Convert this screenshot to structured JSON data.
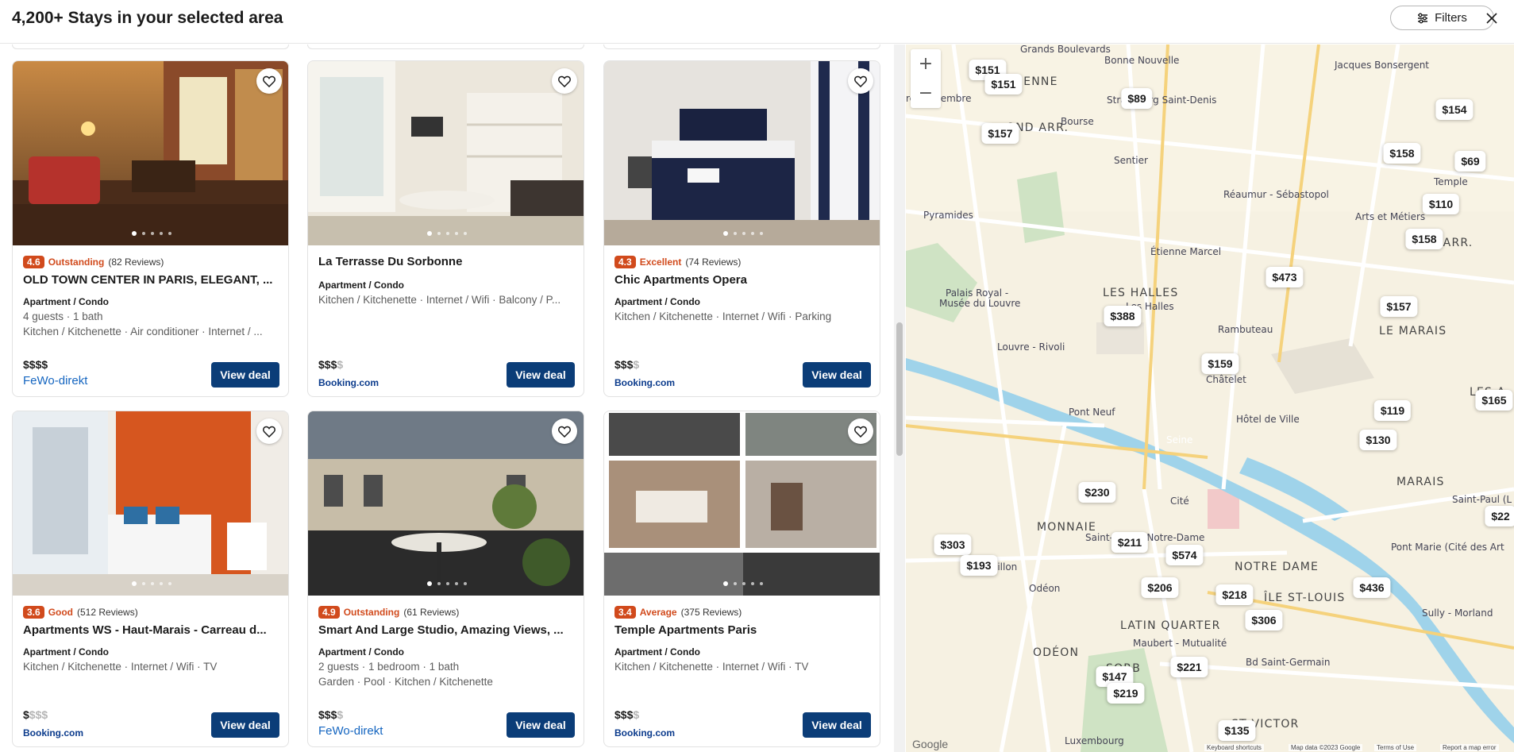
{
  "header": {
    "title": "4,200+ Stays in your selected area",
    "filters_label": "Filters"
  },
  "listings": [
    {
      "score": "4.6",
      "rating_label": "Outstanding",
      "reviews": "(82 Reviews)",
      "name": "OLD TOWN CENTER IN PARIS, ELEGANT, ...",
      "type": "Apartment / Condo",
      "details": [
        "4 guests · 1 bath",
        "Kitchen / Kitchenette · Air conditioner · Internet / ..."
      ],
      "price_active": "$$$$",
      "price_dim": "",
      "provider": "FeWo-direkt",
      "cta": "View deal"
    },
    {
      "score": "",
      "rating_label": "",
      "reviews": "",
      "name": "La Terrasse Du Sorbonne",
      "type": "Apartment / Condo",
      "details": [
        "Kitchen / Kitchenette · Internet / Wifi · Balcony / P..."
      ],
      "price_active": "$$$",
      "price_dim": "$",
      "provider": "Booking.com",
      "cta": "View deal"
    },
    {
      "score": "4.3",
      "rating_label": "Excellent",
      "reviews": "(74 Reviews)",
      "name": "Chic Apartments Opera",
      "type": "Apartment / Condo",
      "details": [
        "Kitchen / Kitchenette · Internet / Wifi · Parking"
      ],
      "price_active": "$$$",
      "price_dim": "$",
      "provider": "Booking.com",
      "cta": "View deal"
    },
    {
      "score": "3.6",
      "rating_label": "Good",
      "reviews": "(512 Reviews)",
      "name": "Apartments WS - Haut-Marais - Carreau d...",
      "type": "Apartment / Condo",
      "details": [
        "Kitchen / Kitchenette · Internet / Wifi · TV"
      ],
      "price_active": "$",
      "price_dim": "$$$",
      "provider": "Booking.com",
      "cta": "View deal"
    },
    {
      "score": "4.9",
      "rating_label": "Outstanding",
      "reviews": "(61 Reviews)",
      "name": "Smart And Large Studio, Amazing Views, ...",
      "type": "Apartment / Condo",
      "details": [
        "2 guests · 1 bedroom · 1 bath",
        "Garden · Pool · Kitchen / Kitchenette"
      ],
      "price_active": "$$$",
      "price_dim": "$",
      "provider": "FeWo-direkt",
      "cta": "View deal"
    },
    {
      "score": "3.4",
      "rating_label": "Average",
      "reviews": "(375 Reviews)",
      "name": "Temple Apartments Paris",
      "type": "Apartment / Condo",
      "details": [
        "Kitchen / Kitchenette · Internet / Wifi · TV"
      ],
      "price_active": "$$$",
      "price_dim": "$",
      "provider": "Booking.com",
      "cta": "View deal"
    }
  ],
  "map": {
    "markers": [
      "$151",
      "$151",
      "$89",
      "$154",
      "$157",
      "$158",
      "$69",
      "$110",
      "$158",
      "$473",
      "$157",
      "$388",
      "$159",
      "$165",
      "$119",
      "$130",
      "$230",
      "$22",
      "$303",
      "$211",
      "$574",
      "$193",
      "$206",
      "$218",
      "$436",
      "$306",
      "$221",
      "$147",
      "$219",
      "$135"
    ],
    "labels": {
      "grands_boulevards": "Grands Boulevards",
      "bonne_nouvelle": "Bonne Nouvelle",
      "strasbourg": "Strasbourg Saint-Denis",
      "jacques_bonsergent": "Jacques Bonsergent",
      "vivienne": "VIVIENNE",
      "quatre_septembre": "re-Septembre",
      "bourse": "Bourse",
      "second_arr": "2ND ARR.",
      "sentier": "Sentier",
      "temple": "Temple",
      "reaumur": "Réaumur - Sébastopol",
      "arts_metiers": "Arts et Métiers",
      "pyramides": "Pyramides",
      "etienne_marcel": "Étienne Marcel",
      "third_arr": "3RD ARR.",
      "les_halles_district": "LES HALLES",
      "les_halles": "Les Halles",
      "palais_royal": "Palais Royal -",
      "musee_louvre": "Musée du Louvre",
      "louvre_rivoli": "Louvre - Rivoli",
      "rambuteau": "Rambuteau",
      "le_marais": "LE MARAIS",
      "pont_neuf": "Pont Neuf",
      "chatelet": "Châtelet",
      "hotel_de_ville": "Hôtel de Ville",
      "les_a": "LES A",
      "seine": "Seine",
      "cite": "Cité",
      "marais": "MARAIS",
      "saint_paul": "Saint-Paul (L",
      "monnaie": "MONNAIE",
      "notre_dame_metro": "Saint-Michel Notre-Dame",
      "pont_marie": "Pont Marie (Cité des Art",
      "notre_dame": "NOTRE DAME",
      "mabillon": "Mabillon",
      "odeon_metro": "Odéon",
      "ile_st_louis": "ÎLE ST-LOUIS",
      "sully": "Sully - Morland",
      "latin_quarter": "LATIN QUARTER",
      "maubert": "Maubert - Mutualité",
      "odeon": "ODÉON",
      "sorbonne": "SORB",
      "bd_saint_germain": "Bd Saint-Germain",
      "luxembourg": "Luxembourg",
      "st_victor": "ST VICTOR",
      "google": "Google"
    },
    "footer": {
      "shortcuts": "Keyboard shortcuts",
      "map_data": "Map data ©2023 Google",
      "terms": "Terms of Use",
      "report": "Report a map error"
    }
  }
}
